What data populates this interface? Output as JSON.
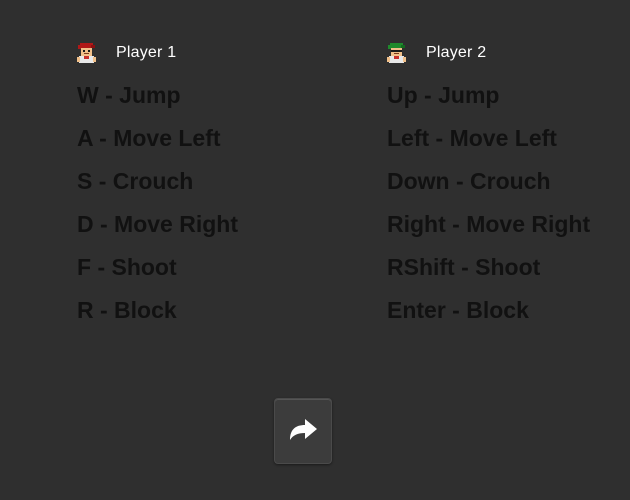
{
  "players": [
    {
      "name": "Player 1",
      "avatar_icon": "red-fighter-icon",
      "hair_color": "#b01818",
      "controls": [
        "W - Jump",
        "A - Move Left",
        "S - Crouch",
        "D - Move Right",
        "F - Shoot",
        "R - Block"
      ]
    },
    {
      "name": "Player 2",
      "avatar_icon": "green-fighter-icon",
      "hair_color": "#1f8a2c",
      "controls": [
        "Up - Jump",
        "Left - Move Left",
        "Down - Crouch",
        "Right - Move Right",
        "RShift - Shoot",
        "Enter - Block"
      ]
    }
  ],
  "next_button": {
    "icon": "forward-arrow-icon"
  },
  "colors": {
    "background": "#2f2f2f",
    "control_text": "#111111",
    "player_label": "#ffffff"
  }
}
